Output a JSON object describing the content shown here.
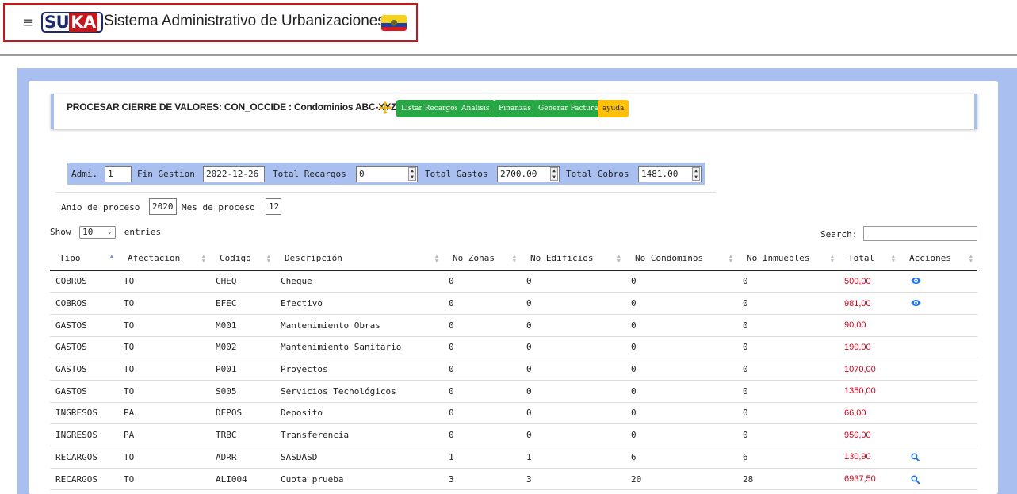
{
  "header": {
    "menu_icon": "hamburger-icon",
    "logo": {
      "part1": "SU",
      "part2": "KA"
    },
    "title": "Sistema Administrativo de Urbanizaciones",
    "flag_icon": "ecuador-flag-icon"
  },
  "panel": {
    "title": "PROCESAR CIERRE DE VALORES: CON_OCCIDE : Condominios ABC-XYZ.",
    "move_icon": "move-arrows-icon",
    "buttons": [
      {
        "label": "Listar Recargos"
      },
      {
        "label": "Analisis"
      },
      {
        "label": "Finanzas"
      },
      {
        "label": "Generar Facturas"
      },
      {
        "label": "ayuda"
      }
    ],
    "colors": {
      "accent": "#a8bff0",
      "success": "#28a745",
      "warning": "#ffc107",
      "total": "#d0021b"
    }
  },
  "filters": {
    "admi_label": "Admi.",
    "admi_value": "1",
    "fin_label": "Fin Gestion",
    "fin_value": "2022-12-26",
    "recargos_label": "Total Recargos",
    "recargos_value": "0",
    "gastos_label": "Total Gastos",
    "gastos_value": "2700.00",
    "cobros_label": "Total Cobros",
    "cobros_value": "1481.00",
    "anio_label": "Anio de proceso",
    "anio_value": "2020",
    "mes_label": "Mes de proceso",
    "mes_value": "12"
  },
  "datatable": {
    "show_label": "Show",
    "length_value": "10",
    "entries_label": "entries",
    "search_label": "Search:",
    "columns": [
      "Tipo",
      "Afectacion",
      "Codigo",
      "Descripción",
      "No Zonas",
      "No Edificios",
      "No Condominos",
      "No Inmuebles",
      "Total",
      "Acciones"
    ],
    "rows": [
      {
        "tipo": "COBROS",
        "afectacion": "TO",
        "codigo": "CHEQ",
        "descripcion": "Cheque",
        "zonas": "0",
        "edificios": "0",
        "condominos": "0",
        "inmuebles": "0",
        "total": "500,00",
        "action": "eye-icon"
      },
      {
        "tipo": "COBROS",
        "afectacion": "TO",
        "codigo": "EFEC",
        "descripcion": "Efectivo",
        "zonas": "0",
        "edificios": "0",
        "condominos": "0",
        "inmuebles": "0",
        "total": "981,00",
        "action": "eye-icon"
      },
      {
        "tipo": "GASTOS",
        "afectacion": "TO",
        "codigo": "M001",
        "descripcion": "Mantenimiento Obras",
        "zonas": "0",
        "edificios": "0",
        "condominos": "0",
        "inmuebles": "0",
        "total": "90,00",
        "action": ""
      },
      {
        "tipo": "GASTOS",
        "afectacion": "TO",
        "codigo": "M002",
        "descripcion": "Mantenimiento Sanitario",
        "zonas": "0",
        "edificios": "0",
        "condominos": "0",
        "inmuebles": "0",
        "total": "190,00",
        "action": ""
      },
      {
        "tipo": "GASTOS",
        "afectacion": "TO",
        "codigo": "P001",
        "descripcion": "Proyectos",
        "zonas": "0",
        "edificios": "0",
        "condominos": "0",
        "inmuebles": "0",
        "total": "1070,00",
        "action": ""
      },
      {
        "tipo": "GASTOS",
        "afectacion": "TO",
        "codigo": "S005",
        "descripcion": "Servicios Tecnológicos",
        "zonas": "0",
        "edificios": "0",
        "condominos": "0",
        "inmuebles": "0",
        "total": "1350,00",
        "action": ""
      },
      {
        "tipo": "INGRESOS",
        "afectacion": "PA",
        "codigo": "DEPOS",
        "descripcion": "Deposito",
        "zonas": "0",
        "edificios": "0",
        "condominos": "0",
        "inmuebles": "0",
        "total": "66,00",
        "action": ""
      },
      {
        "tipo": "INGRESOS",
        "afectacion": "PA",
        "codigo": "TRBC",
        "descripcion": "Transferencia",
        "zonas": "0",
        "edificios": "0",
        "condominos": "0",
        "inmuebles": "0",
        "total": "950,00",
        "action": ""
      },
      {
        "tipo": "RECARGOS",
        "afectacion": "TO",
        "codigo": "ADRR",
        "descripcion": "SASDASD",
        "zonas": "1",
        "edificios": "1",
        "condominos": "6",
        "inmuebles": "6",
        "total": "130,90",
        "action": "search-icon"
      },
      {
        "tipo": "RECARGOS",
        "afectacion": "TO",
        "codigo": "ALI004",
        "descripcion": "Cuota prueba",
        "zonas": "3",
        "edificios": "3",
        "condominos": "20",
        "inmuebles": "28",
        "total": "6937,50",
        "action": "search-icon"
      }
    ]
  }
}
